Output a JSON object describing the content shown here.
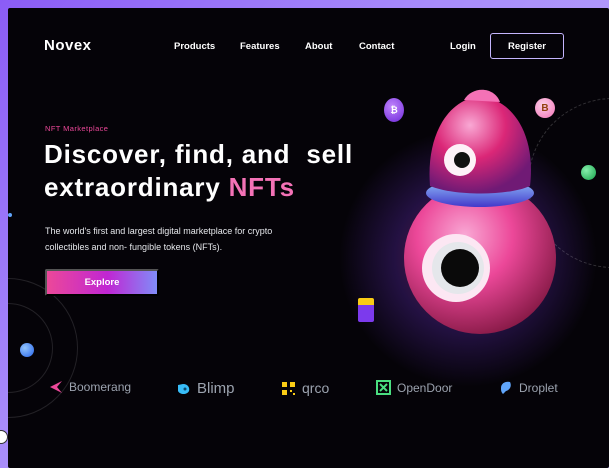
{
  "brand": "Novex",
  "nav": {
    "products": "Products",
    "features": "Features",
    "about": "About",
    "contact": "Contact"
  },
  "auth": {
    "login": "Login",
    "register": "Register"
  },
  "hero": {
    "eyebrow": "NFT Marketplace",
    "title_line1": "Discover, find, and  sell",
    "title_line2_prefix": "extraordinary ",
    "title_line2_accent": "NFTs",
    "description": "The world's first and largest digital marketplace for crypto collectibles and non- fungible tokens (NFTs).",
    "cta": "Explore"
  },
  "partners": [
    {
      "name": "Boomerang",
      "icon": "boomerang-icon",
      "color": "#ec4899"
    },
    {
      "name": "Blimp",
      "icon": "blimp-icon",
      "color": "#38bdf8"
    },
    {
      "name": "qrco",
      "icon": "qrco-icon",
      "color": "#facc15"
    },
    {
      "name": "OpenDoor",
      "icon": "opendoor-icon",
      "color": "#4ade80"
    },
    {
      "name": "Droplet",
      "icon": "droplet-icon",
      "color": "#60a5fa"
    }
  ],
  "colors": {
    "background": "#050308",
    "accent_pink": "#ec4899",
    "accent_violet": "#8b5cf6"
  }
}
